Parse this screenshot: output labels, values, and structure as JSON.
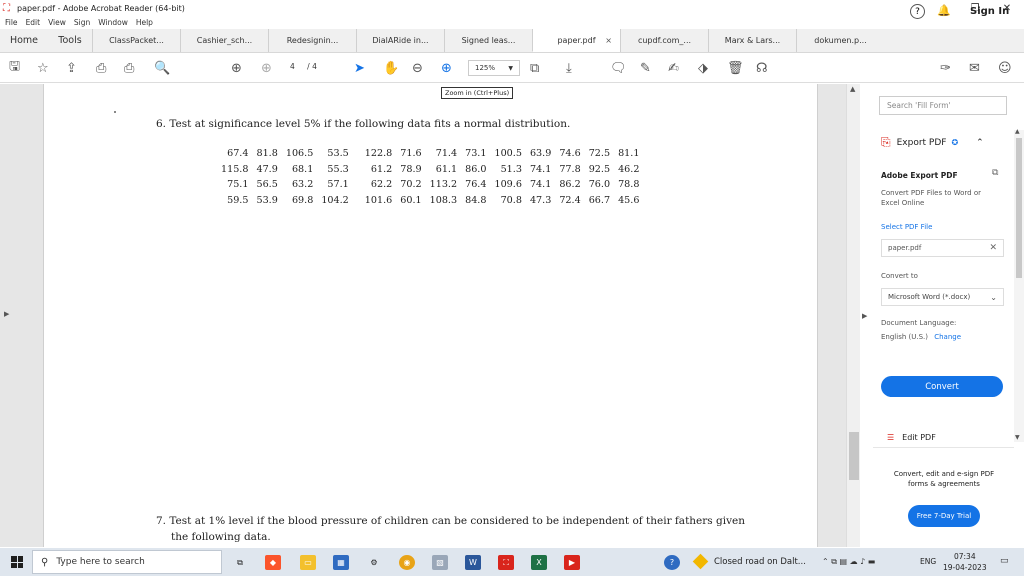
{
  "window": {
    "title": "paper.pdf - Adobe Acrobat Reader (64-bit)",
    "minimize": "–",
    "restore": "❐",
    "close": "✕"
  },
  "menu": [
    "File",
    "Edit",
    "View",
    "Sign",
    "Window",
    "Help"
  ],
  "tabs": {
    "home": "Home",
    "tools": "Tools",
    "docs": [
      {
        "label": "ClassPacket...",
        "active": false
      },
      {
        "label": "Cashier_sch...",
        "active": false
      },
      {
        "label": "Redesignin...",
        "active": false
      },
      {
        "label": "DialARide in...",
        "active": false
      },
      {
        "label": "Signed leas...",
        "active": false
      },
      {
        "label": "paper.pdf",
        "active": true,
        "close": "×"
      },
      {
        "label": "cupdf.com_...",
        "active": false
      },
      {
        "label": "Marx & Lars...",
        "active": false
      },
      {
        "label": "dokumen.p...",
        "active": false
      }
    ],
    "help": "?",
    "sign_in": "Sign In"
  },
  "toolbar": {
    "page_current": "4",
    "page_total": "/ 4",
    "zoom": "125%",
    "zoom_tooltip": "Zoom in (Ctrl+Plus)"
  },
  "document": {
    "q6": "6.  Test at significance level 5% if the following data fits a normal distribution.",
    "rows": [
      [
        "67.4",
        "81.8",
        "106.5",
        "53.5",
        "122.8",
        "71.6",
        "71.4",
        "73.1",
        "100.5",
        "63.9",
        "74.6",
        "72.5",
        "81.1"
      ],
      [
        "115.8",
        "47.9",
        "68.1",
        "55.3",
        "61.2",
        "78.9",
        "61.1",
        "86.0",
        "51.3",
        "74.1",
        "77.8",
        "92.5",
        "46.2"
      ],
      [
        "75.1",
        "56.5",
        "63.2",
        "57.1",
        "62.2",
        "70.2",
        "113.2",
        "76.4",
        "109.6",
        "74.1",
        "86.2",
        "76.0",
        "78.8"
      ],
      [
        "59.5",
        "53.9",
        "69.8",
        "104.2",
        "101.6",
        "60.1",
        "108.3",
        "84.8",
        "70.8",
        "47.3",
        "72.4",
        "66.7",
        "45.6"
      ]
    ],
    "q7_line1": "7.  Test at 1% level if the blood pressure of children can be considered to be independent of their fathers given",
    "q7_line2": "the following data."
  },
  "panel": {
    "search_placeholder": "Search 'Fill Form'",
    "export_title": "Export PDF",
    "export_section_title": "Adobe Export PDF",
    "export_desc": "Convert PDF Files to Word or Excel Online",
    "select_file": "Select PDF File",
    "file_name": "paper.pdf",
    "convert_to_label": "Convert to",
    "convert_to_value": "Microsoft Word (*.docx)",
    "doc_language_label": "Document Language:",
    "doc_language_value": "English (U.S.)",
    "change_link": "Change",
    "convert_button": "Convert",
    "edit_pdf": "Edit PDF",
    "promo_text": "Convert, edit and e-sign PDF forms & agreements",
    "trial_button": "Free 7-Day Trial"
  },
  "taskbar": {
    "search_placeholder": "Type here to search",
    "weather": "Closed road on Dalt...",
    "language": "ENG",
    "time": "07:34",
    "date": "19-04-2023"
  },
  "colors": {
    "accent": "#1473e6",
    "pdf_red": "#d9251c"
  }
}
